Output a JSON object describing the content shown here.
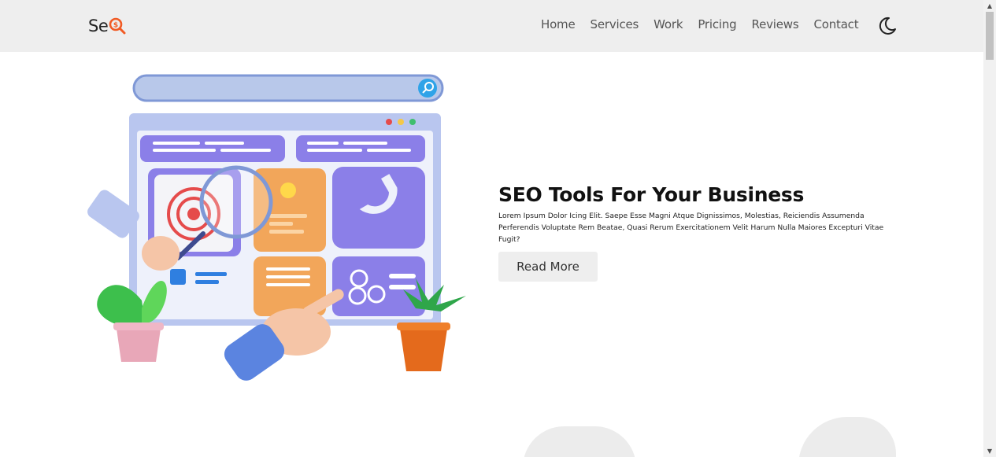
{
  "header": {
    "logo_text": "Se",
    "logo_mark": "magnifier-dollar-icon",
    "nav": [
      "Home",
      "Services",
      "Work",
      "Pricing",
      "Reviews",
      "Contact"
    ],
    "theme_icon": "moon-icon"
  },
  "hero": {
    "illustration": "seo-dashboard-illustration",
    "title": "SEO Tools For Your Business",
    "description": "Lorem Ipsum Dolor Icing Elit. Saepe Esse Magni Atque Dignissimos, Molestias, Reiciendis Assumenda Perferendis Voluptate Rem Beatae, Quasi Rerum Exercitationem Velit Harum Nulla Maiores Excepturi Vitae Fugit?",
    "button_label": "Read More"
  },
  "colors": {
    "header_bg": "#eeeeee",
    "accent": "#f15a24",
    "illustration_purple": "#8b7fe8",
    "illustration_orange": "#f2a65a"
  },
  "scrollbar": {
    "up_icon": "triangle-up-icon",
    "down_icon": "triangle-down-icon"
  }
}
